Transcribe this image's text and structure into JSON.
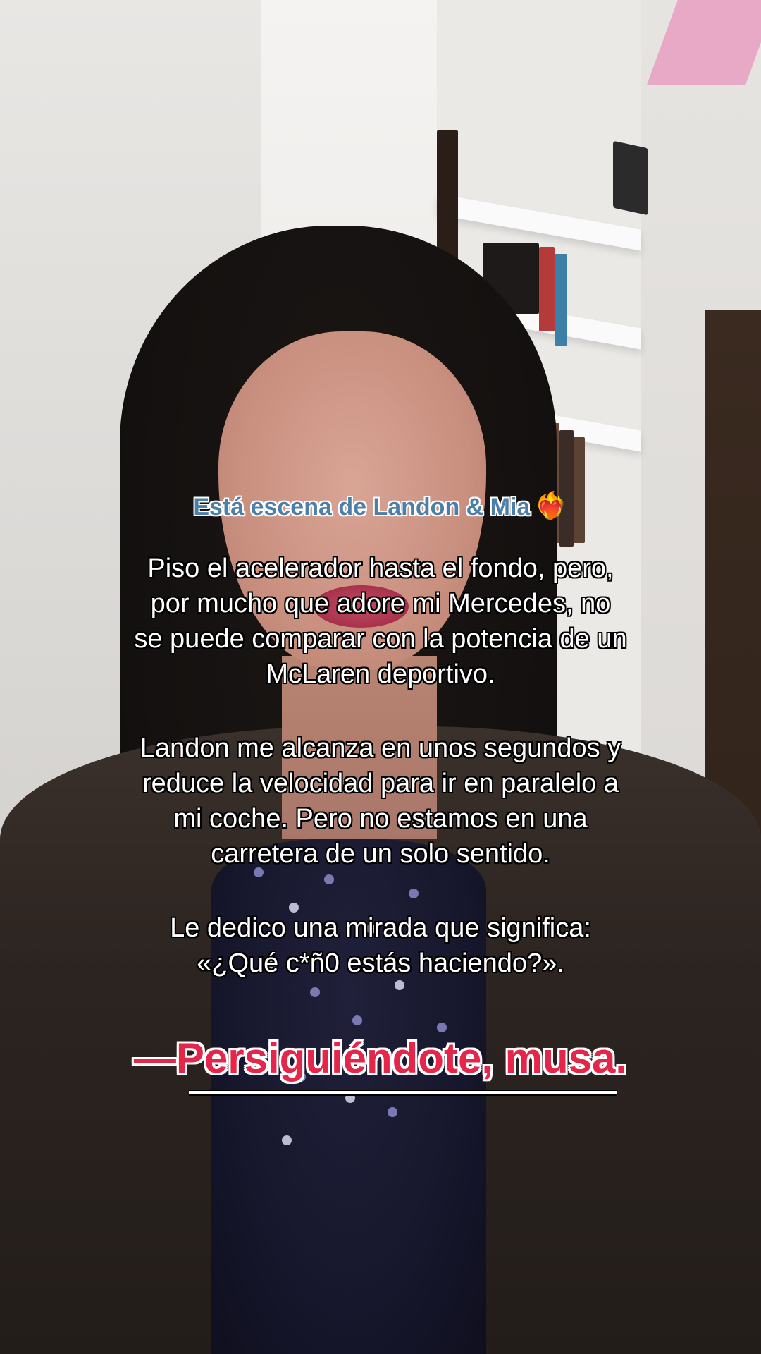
{
  "scene": {
    "description_tag": "video-frame"
  },
  "captions": {
    "intro": "Está escena de Landon & Mia",
    "intro_emoji": "❤️‍🔥",
    "paragraph_1": [
      "Piso el acelerador hasta el fondo, pero,",
      "por mucho que adore mi Mercedes, no",
      "se puede comparar con la potencia de un",
      "McLaren deportivo."
    ],
    "paragraph_2": [
      "Landon me alcanza en unos segundos y",
      "reduce la velocidad para ir en paralelo a",
      "mi coche. Pero no estamos en una",
      "carretera de un solo sentido."
    ],
    "paragraph_3": [
      "Le dedico una mirada que significa:",
      "«¿Qué c*ñ0 estás haciendo?»."
    ],
    "quote": "—Persiguiéndote, musa."
  },
  "colors": {
    "intro": "#4b7fa8",
    "body": "#ffffff",
    "quote": "#e4264a"
  }
}
